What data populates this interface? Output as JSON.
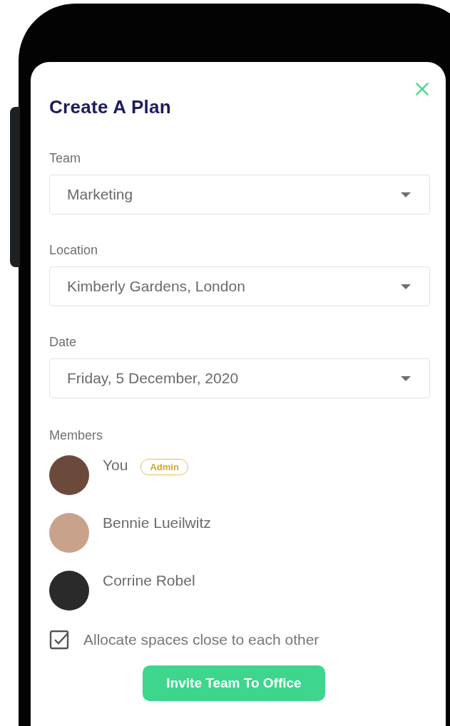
{
  "dialog": {
    "title": "Create A Plan"
  },
  "fields": [
    {
      "label": "Team",
      "value": "Marketing"
    },
    {
      "label": "Location",
      "value": "Kimberly Gardens, London"
    },
    {
      "label": "Date",
      "value": "Friday, 5 December, 2020"
    }
  ],
  "members": {
    "label": "Members",
    "items": [
      {
        "name": "You",
        "badge": "Admin"
      },
      {
        "name": "Bennie Lueilwitz"
      },
      {
        "name": "Corrine Robel"
      }
    ]
  },
  "option": {
    "label": "Allocate spaces close to each other",
    "checked": true
  },
  "submit": {
    "label": "Invite Team To Office"
  }
}
